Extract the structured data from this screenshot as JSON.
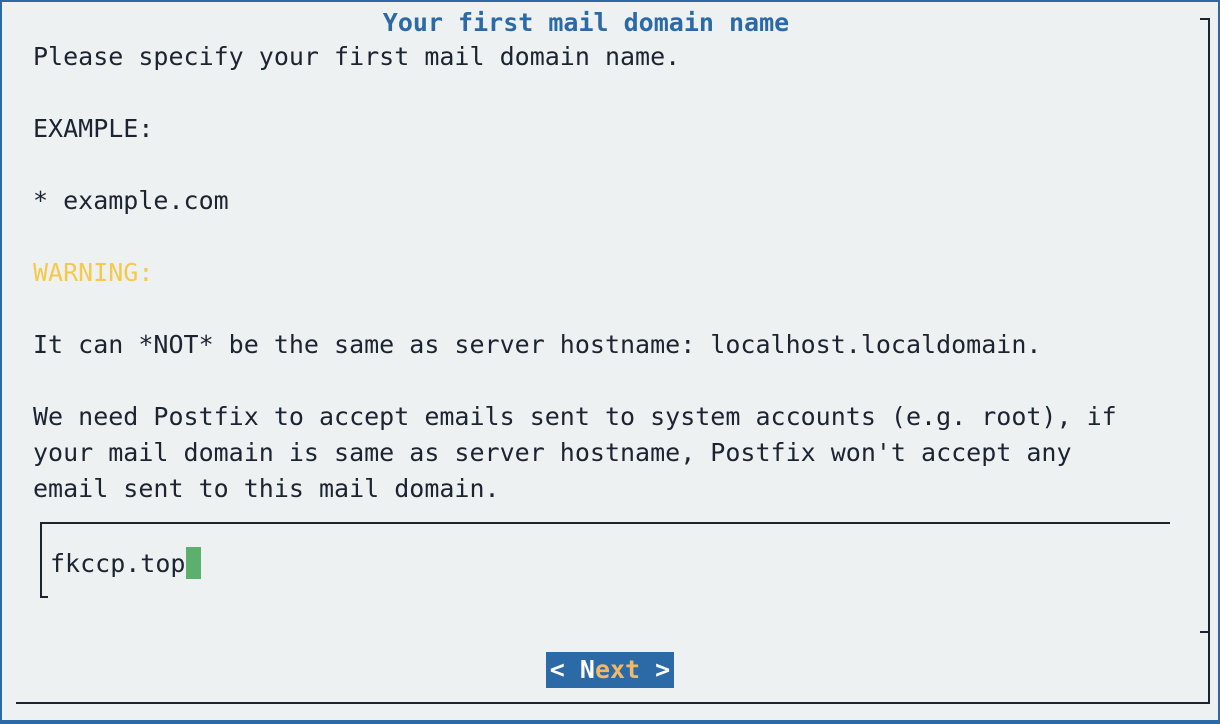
{
  "dialog": {
    "title": "Your first mail domain name",
    "lines": {
      "intro": "Please specify your first mail domain name.",
      "example_heading": "EXAMPLE:",
      "example_item": "* example.com",
      "warning": "WARNING:",
      "hostname_note": "It can *NOT* be the same as server hostname: localhost.localdomain.",
      "explain_1": "We need Postfix to accept emails sent to system accounts (e.g. root), if",
      "explain_2": "your mail domain is same as server hostname, Postfix won't accept any",
      "explain_3": "email sent to this mail domain."
    },
    "input": {
      "value": "fkccp.top"
    },
    "next_button": {
      "left": "< ",
      "hotkey": "N",
      "rest": "ext",
      "right": " >"
    }
  },
  "colors": {
    "accent": "#2b6aa6",
    "warning": "#f6c94a",
    "cursor": "#5cb06e",
    "button_hotkey_rest": "#f3b866",
    "background": "#eef1f2",
    "text": "#1c2331"
  }
}
